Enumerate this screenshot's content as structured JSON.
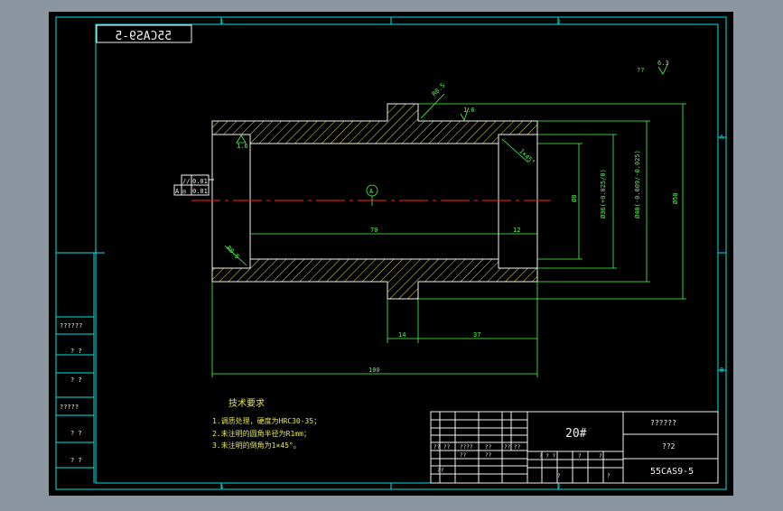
{
  "colors": {
    "background": "#000000",
    "frame": "#00e5e5",
    "outline": "#f2f2f2",
    "section": "#e8e84a",
    "dimension": "#4cff4c",
    "centerline": "#ff2020",
    "chrome": "#8c96a0"
  },
  "drawing": {
    "code_mirrored": "55CAS9-5",
    "zone_numbers": [
      "1",
      "2",
      "3"
    ],
    "zone_letters": [
      "A",
      "B"
    ],
    "roughness_main": "??",
    "roughness_value": "6.3"
  },
  "annotations": {
    "datum": "A",
    "roughness_top": "1.6",
    "roughness_left": "1.6",
    "chamfer_top": "R0.5",
    "chamfer_right": "1×45°",
    "chamfer_left": "R0.5",
    "tolerance_box_1": "0.01",
    "tolerance_box_2": "0.01",
    "tolerance_sym_1": "//",
    "tolerance_sym_2": "◎",
    "tolerance_ref": "A"
  },
  "dimensions": {
    "bore_length": "70",
    "counterbore_length": "12",
    "collar_width": "14",
    "right_length": "37",
    "overall_length": "100",
    "dia_1": "Ø8",
    "dia_2": "Ø36(+0.025/0)",
    "dia_3": "Ø40(-0.009/-0.025)",
    "dia_4": "Ø50"
  },
  "tech_requirements": {
    "title": "技术要求",
    "line1": "1.调质处理，硬度为HRC30-35；",
    "line2": "2.未注明的圆角半径为R1mm；",
    "line3": "3.未注明的倒角为1×45°。"
  },
  "left_column": {
    "cells": [
      "??????",
      "? ?",
      "? ?",
      "?????",
      "? ?",
      "? ?"
    ]
  },
  "title_block": {
    "material": "20#",
    "name": "??????",
    "scale_label": "??2",
    "drawing_number": "55CAS9-5",
    "small_cells": [
      "??",
      "??",
      "????",
      "??",
      "??",
      "??",
      "??",
      "??",
      "??",
      "? ? ?",
      "?",
      "?",
      "?",
      "?"
    ]
  }
}
